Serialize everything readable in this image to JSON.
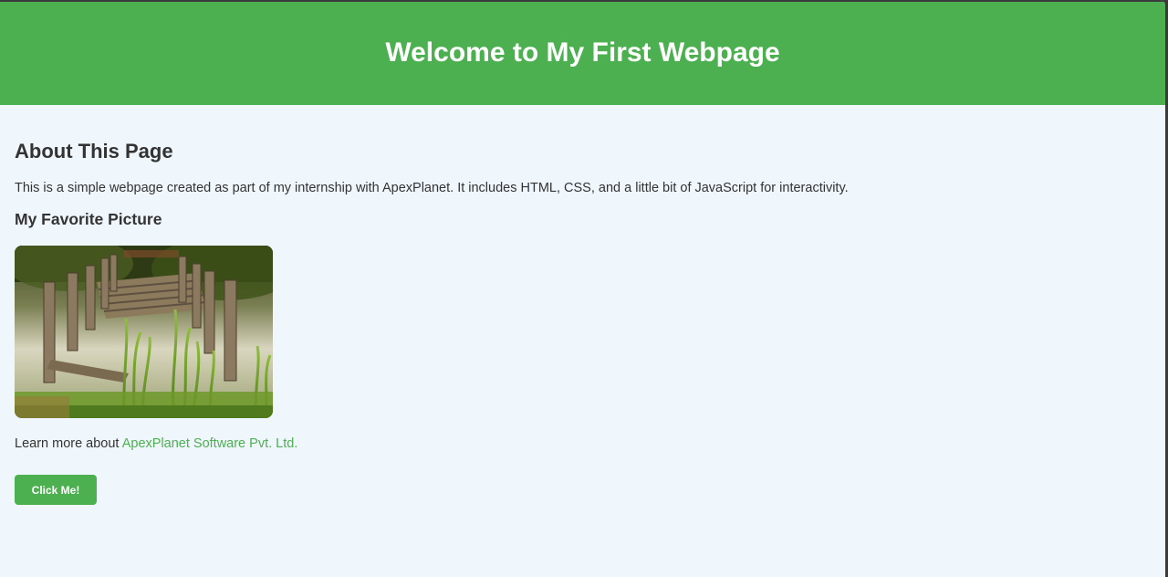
{
  "header": {
    "title": "Welcome to My First Webpage"
  },
  "about": {
    "heading": "About This Page",
    "text": "This is a simple webpage created as part of my internship with ApexPlanet. It includes HTML, CSS, and a little bit of JavaScript for interactivity."
  },
  "picture_section": {
    "heading": "My Favorite Picture",
    "image": "old wooden pier in pond with reeds"
  },
  "learn_more": {
    "prefix": "Learn more about ",
    "link_text": "ApexPlanet Software Pvt. Ltd."
  },
  "button": {
    "label": "Click Me!"
  },
  "colors": {
    "accent": "#4caf50",
    "background": "#eff7fd",
    "text": "#333333"
  }
}
